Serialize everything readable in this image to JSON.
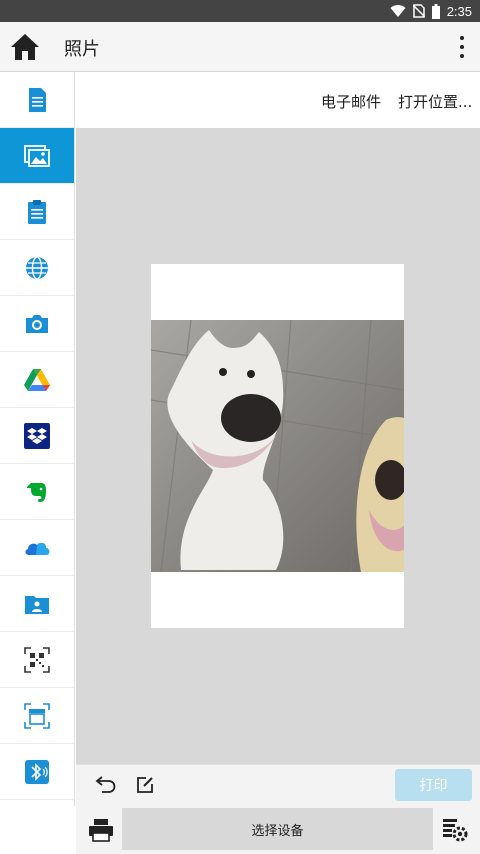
{
  "status_bar": {
    "time": "2:35"
  },
  "app_bar": {
    "title": "照片"
  },
  "sidebar": {
    "items": [
      {
        "name": "document",
        "icon": "document-icon",
        "active": false
      },
      {
        "name": "photos",
        "icon": "photos-icon",
        "active": true
      },
      {
        "name": "clipboard",
        "icon": "clipboard-icon",
        "active": false
      },
      {
        "name": "web",
        "icon": "globe-icon",
        "active": false
      },
      {
        "name": "camera",
        "icon": "camera-icon",
        "active": false
      },
      {
        "name": "google-drive",
        "icon": "google-drive-icon",
        "active": false
      },
      {
        "name": "dropbox",
        "icon": "dropbox-icon",
        "active": false
      },
      {
        "name": "evernote",
        "icon": "evernote-icon",
        "active": false
      },
      {
        "name": "onedrive",
        "icon": "onedrive-icon",
        "active": false
      },
      {
        "name": "shared-folder",
        "icon": "shared-folder-icon",
        "active": false
      },
      {
        "name": "qr-scan",
        "icon": "qr-code-icon",
        "active": false
      },
      {
        "name": "scanner",
        "icon": "scanner-icon",
        "active": false
      },
      {
        "name": "bluetooth",
        "icon": "bluetooth-icon",
        "active": false
      }
    ]
  },
  "actions": {
    "email_label": "电子邮件",
    "open_location_label": "打开位置..."
  },
  "toolbar": {
    "print_label": "打印"
  },
  "bottom_bar": {
    "select_device_label": "选择设备"
  },
  "colors": {
    "accent": "#0e96d6",
    "print_disabled": "#b8dff0",
    "preview_bg": "#d8d8d8"
  }
}
